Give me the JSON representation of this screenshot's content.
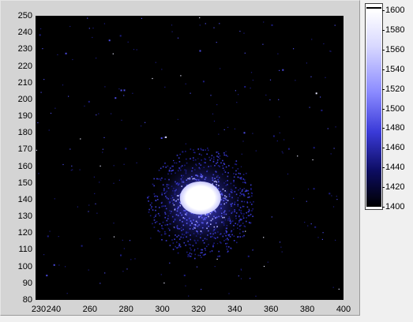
{
  "intensity_graph": {
    "x_axis": {
      "ticks": [
        "230",
        "240",
        "260",
        "280",
        "300",
        "320",
        "340",
        "360",
        "380",
        "400"
      ],
      "values": [
        230,
        240,
        260,
        280,
        300,
        320,
        340,
        360,
        380,
        400
      ],
      "range": [
        230,
        400
      ]
    },
    "y_axis": {
      "ticks": [
        "250",
        "240",
        "230",
        "220",
        "210",
        "200",
        "190",
        "180",
        "170",
        "160",
        "150",
        "140",
        "130",
        "120",
        "110",
        "100",
        "90",
        "80"
      ],
      "values": [
        250,
        240,
        230,
        220,
        210,
        200,
        190,
        180,
        170,
        160,
        150,
        140,
        130,
        120,
        110,
        100,
        90,
        80
      ],
      "range": [
        80,
        250
      ]
    },
    "spot_center": [
      321,
      141
    ],
    "background": "#000000"
  },
  "colorbar": {
    "ticks": [
      "1600",
      "1580",
      "1560",
      "1540",
      "1520",
      "1500",
      "1480",
      "1460",
      "1440",
      "1420",
      "1400"
    ],
    "values": [
      1600,
      1580,
      1560,
      1540,
      1520,
      1500,
      1480,
      1460,
      1440,
      1420,
      1400
    ],
    "range": [
      1400,
      1600
    ],
    "colors": [
      "#000000",
      "#0c0c60",
      "#3a3ad8",
      "#8a8aff",
      "#d9d9ff",
      "#ffffff"
    ]
  }
}
